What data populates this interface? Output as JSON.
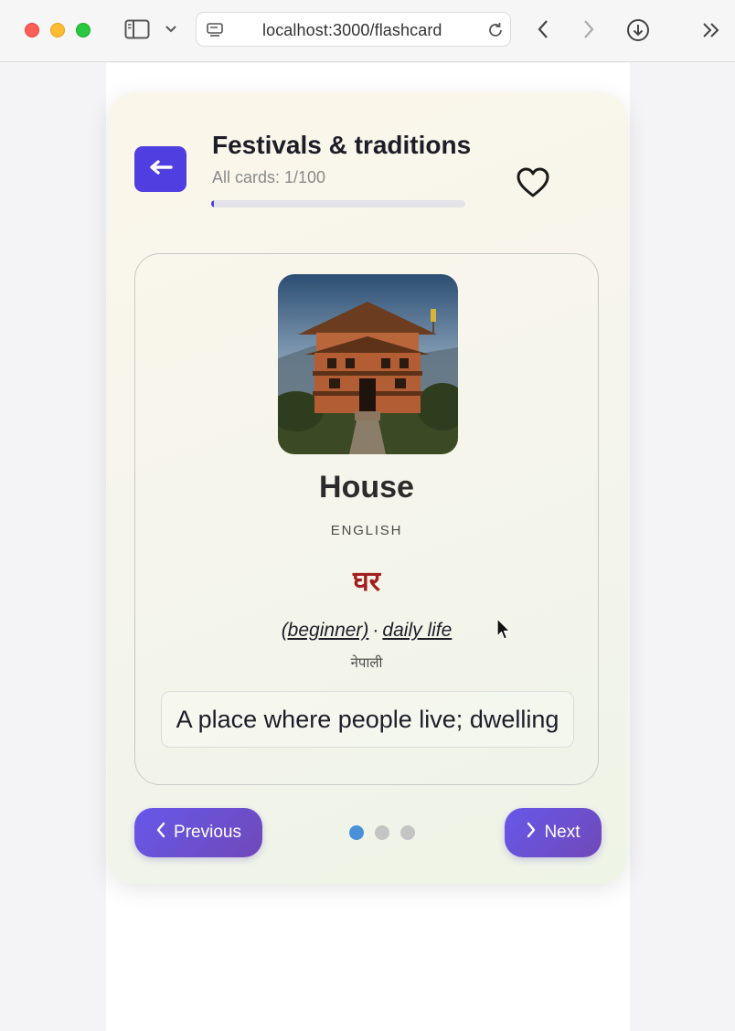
{
  "browser": {
    "url": "localhost:3000/flashcard"
  },
  "header": {
    "title": "Festivals & traditions",
    "subtitle": "All cards: 1/100",
    "progress": 0.01
  },
  "card": {
    "word": "House",
    "language_label": "ENGLISH",
    "translation": "घर",
    "level": "(beginner)",
    "separator": "·",
    "category": "daily life",
    "native_language": "नेपाली",
    "definition": "A place where people live; dwelling"
  },
  "navigation": {
    "previous_label": "Previous",
    "next_label": "Next",
    "dots": [
      true,
      false,
      false
    ]
  },
  "colors": {
    "accent": "#4f3ee0",
    "translation": "#a31f1f",
    "active_dot": "#4a90d9"
  }
}
